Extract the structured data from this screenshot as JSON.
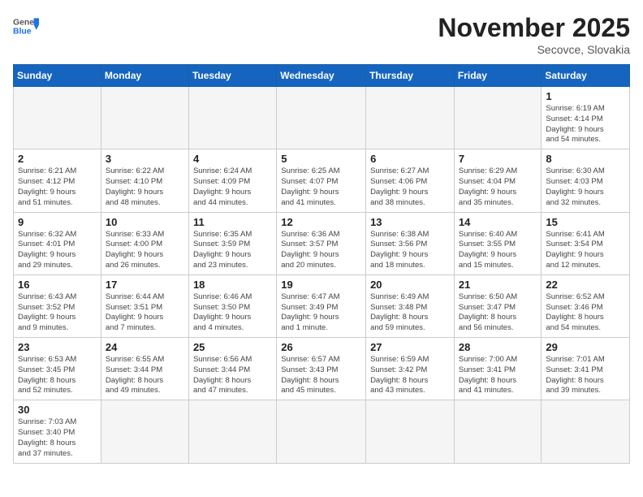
{
  "header": {
    "logo_general": "General",
    "logo_blue": "Blue",
    "month_title": "November 2025",
    "location": "Secovce, Slovakia"
  },
  "weekdays": [
    "Sunday",
    "Monday",
    "Tuesday",
    "Wednesday",
    "Thursday",
    "Friday",
    "Saturday"
  ],
  "weeks": [
    [
      {
        "day": "",
        "info": ""
      },
      {
        "day": "",
        "info": ""
      },
      {
        "day": "",
        "info": ""
      },
      {
        "day": "",
        "info": ""
      },
      {
        "day": "",
        "info": ""
      },
      {
        "day": "",
        "info": ""
      },
      {
        "day": "1",
        "info": "Sunrise: 6:19 AM\nSunset: 4:14 PM\nDaylight: 9 hours\nand 54 minutes."
      }
    ],
    [
      {
        "day": "2",
        "info": "Sunrise: 6:21 AM\nSunset: 4:12 PM\nDaylight: 9 hours\nand 51 minutes."
      },
      {
        "day": "3",
        "info": "Sunrise: 6:22 AM\nSunset: 4:10 PM\nDaylight: 9 hours\nand 48 minutes."
      },
      {
        "day": "4",
        "info": "Sunrise: 6:24 AM\nSunset: 4:09 PM\nDaylight: 9 hours\nand 44 minutes."
      },
      {
        "day": "5",
        "info": "Sunrise: 6:25 AM\nSunset: 4:07 PM\nDaylight: 9 hours\nand 41 minutes."
      },
      {
        "day": "6",
        "info": "Sunrise: 6:27 AM\nSunset: 4:06 PM\nDaylight: 9 hours\nand 38 minutes."
      },
      {
        "day": "7",
        "info": "Sunrise: 6:29 AM\nSunset: 4:04 PM\nDaylight: 9 hours\nand 35 minutes."
      },
      {
        "day": "8",
        "info": "Sunrise: 6:30 AM\nSunset: 4:03 PM\nDaylight: 9 hours\nand 32 minutes."
      }
    ],
    [
      {
        "day": "9",
        "info": "Sunrise: 6:32 AM\nSunset: 4:01 PM\nDaylight: 9 hours\nand 29 minutes."
      },
      {
        "day": "10",
        "info": "Sunrise: 6:33 AM\nSunset: 4:00 PM\nDaylight: 9 hours\nand 26 minutes."
      },
      {
        "day": "11",
        "info": "Sunrise: 6:35 AM\nSunset: 3:59 PM\nDaylight: 9 hours\nand 23 minutes."
      },
      {
        "day": "12",
        "info": "Sunrise: 6:36 AM\nSunset: 3:57 PM\nDaylight: 9 hours\nand 20 minutes."
      },
      {
        "day": "13",
        "info": "Sunrise: 6:38 AM\nSunset: 3:56 PM\nDaylight: 9 hours\nand 18 minutes."
      },
      {
        "day": "14",
        "info": "Sunrise: 6:40 AM\nSunset: 3:55 PM\nDaylight: 9 hours\nand 15 minutes."
      },
      {
        "day": "15",
        "info": "Sunrise: 6:41 AM\nSunset: 3:54 PM\nDaylight: 9 hours\nand 12 minutes."
      }
    ],
    [
      {
        "day": "16",
        "info": "Sunrise: 6:43 AM\nSunset: 3:52 PM\nDaylight: 9 hours\nand 9 minutes."
      },
      {
        "day": "17",
        "info": "Sunrise: 6:44 AM\nSunset: 3:51 PM\nDaylight: 9 hours\nand 7 minutes."
      },
      {
        "day": "18",
        "info": "Sunrise: 6:46 AM\nSunset: 3:50 PM\nDaylight: 9 hours\nand 4 minutes."
      },
      {
        "day": "19",
        "info": "Sunrise: 6:47 AM\nSunset: 3:49 PM\nDaylight: 9 hours\nand 1 minute."
      },
      {
        "day": "20",
        "info": "Sunrise: 6:49 AM\nSunset: 3:48 PM\nDaylight: 8 hours\nand 59 minutes."
      },
      {
        "day": "21",
        "info": "Sunrise: 6:50 AM\nSunset: 3:47 PM\nDaylight: 8 hours\nand 56 minutes."
      },
      {
        "day": "22",
        "info": "Sunrise: 6:52 AM\nSunset: 3:46 PM\nDaylight: 8 hours\nand 54 minutes."
      }
    ],
    [
      {
        "day": "23",
        "info": "Sunrise: 6:53 AM\nSunset: 3:45 PM\nDaylight: 8 hours\nand 52 minutes."
      },
      {
        "day": "24",
        "info": "Sunrise: 6:55 AM\nSunset: 3:44 PM\nDaylight: 8 hours\nand 49 minutes."
      },
      {
        "day": "25",
        "info": "Sunrise: 6:56 AM\nSunset: 3:44 PM\nDaylight: 8 hours\nand 47 minutes."
      },
      {
        "day": "26",
        "info": "Sunrise: 6:57 AM\nSunset: 3:43 PM\nDaylight: 8 hours\nand 45 minutes."
      },
      {
        "day": "27",
        "info": "Sunrise: 6:59 AM\nSunset: 3:42 PM\nDaylight: 8 hours\nand 43 minutes."
      },
      {
        "day": "28",
        "info": "Sunrise: 7:00 AM\nSunset: 3:41 PM\nDaylight: 8 hours\nand 41 minutes."
      },
      {
        "day": "29",
        "info": "Sunrise: 7:01 AM\nSunset: 3:41 PM\nDaylight: 8 hours\nand 39 minutes."
      }
    ],
    [
      {
        "day": "30",
        "info": "Sunrise: 7:03 AM\nSunset: 3:40 PM\nDaylight: 8 hours\nand 37 minutes."
      },
      {
        "day": "",
        "info": ""
      },
      {
        "day": "",
        "info": ""
      },
      {
        "day": "",
        "info": ""
      },
      {
        "day": "",
        "info": ""
      },
      {
        "day": "",
        "info": ""
      },
      {
        "day": "",
        "info": ""
      }
    ]
  ]
}
